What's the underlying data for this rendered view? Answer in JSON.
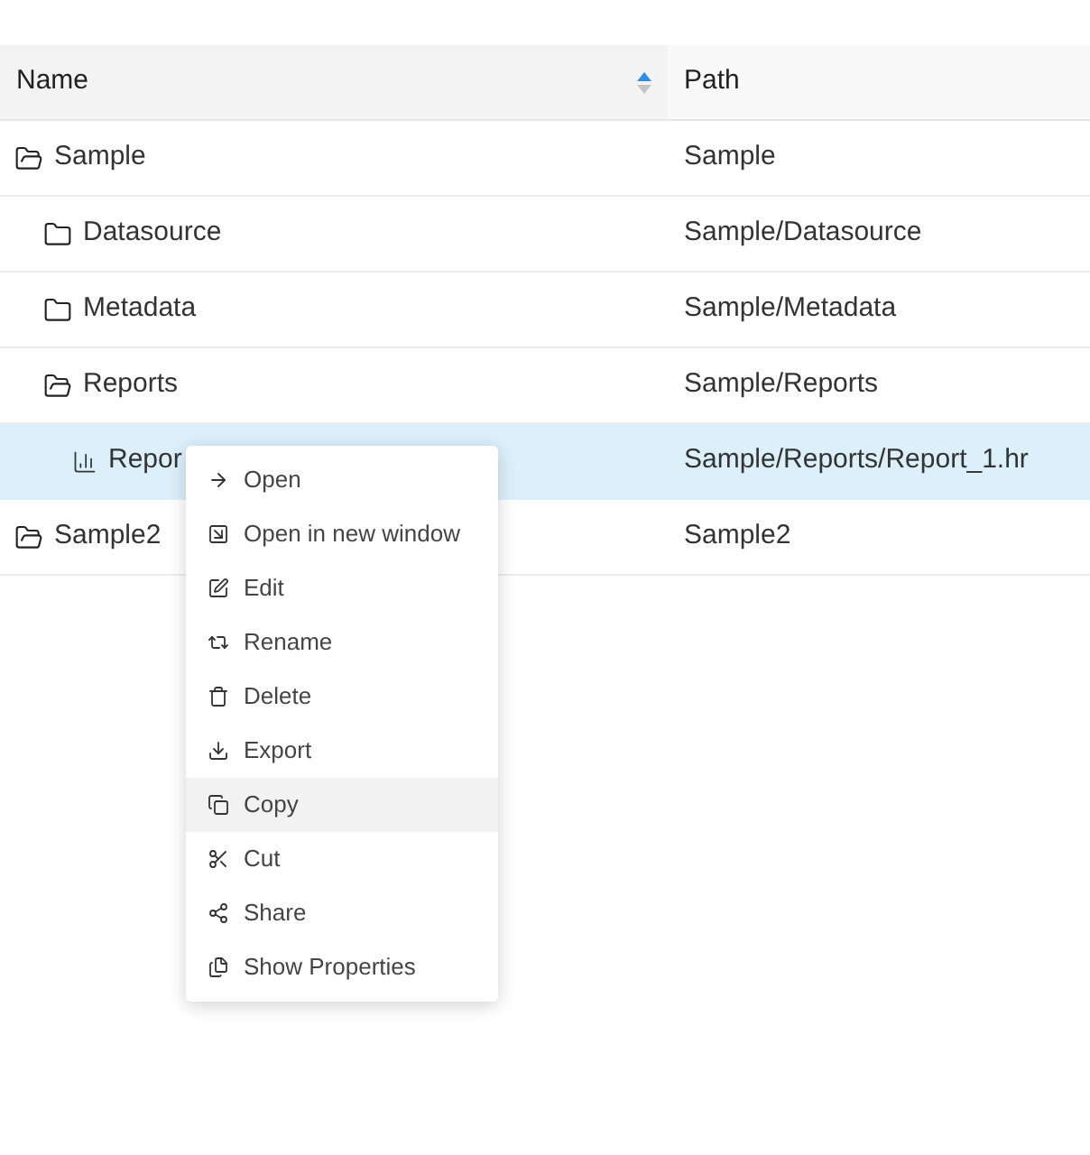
{
  "table": {
    "columns": [
      {
        "label": "Name",
        "sort_ascending": true
      },
      {
        "label": "Path"
      }
    ],
    "rows": [
      {
        "name": "Sample",
        "path": "Sample",
        "kind": "folder",
        "expanded": true,
        "selected": false,
        "children": [
          {
            "name": "Datasource",
            "path": "Sample/Datasource",
            "kind": "folder",
            "expanded": false,
            "selected": false
          },
          {
            "name": "Metadata",
            "path": "Sample/Metadata",
            "kind": "folder",
            "expanded": false,
            "selected": false
          },
          {
            "name": "Reports",
            "path": "Sample/Reports",
            "kind": "folder",
            "expanded": true,
            "selected": false,
            "children": [
              {
                "name": "Repor",
                "path": "Sample/Reports/Report_1.hr",
                "kind": "report",
                "selected": true
              }
            ]
          }
        ]
      },
      {
        "name": "Sample2",
        "path": "Sample2",
        "kind": "folder",
        "expanded": true,
        "selected": false
      }
    ]
  },
  "context_menu": {
    "items": [
      {
        "label": "Open",
        "kind": "open",
        "hovered": false
      },
      {
        "label": "Open in new window",
        "kind": "open_new",
        "hovered": false
      },
      {
        "label": "Edit",
        "kind": "edit",
        "hovered": false
      },
      {
        "label": "Rename",
        "kind": "rename",
        "hovered": false
      },
      {
        "label": "Delete",
        "kind": "delete",
        "hovered": false
      },
      {
        "label": "Export",
        "kind": "export",
        "hovered": false
      },
      {
        "label": "Copy",
        "kind": "copy",
        "hovered": true
      },
      {
        "label": "Cut",
        "kind": "cut",
        "hovered": false
      },
      {
        "label": "Share",
        "kind": "share",
        "hovered": false
      },
      {
        "label": "Show Properties",
        "kind": "properties",
        "hovered": false
      }
    ]
  }
}
